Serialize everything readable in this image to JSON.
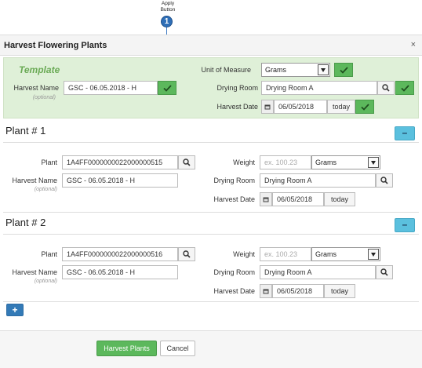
{
  "callout": {
    "label_line1": "Apply",
    "label_line2": "Button",
    "number": "1"
  },
  "dialog": {
    "title": "Harvest Flowering Plants",
    "close": "×"
  },
  "template": {
    "title": "Template",
    "harvest_name_label": "Harvest Name",
    "optional_label": "(optional)",
    "harvest_name_value": "GSC - 06.05.2018 - H",
    "unit_label": "Unit of Measure",
    "unit_value": "Grams",
    "drying_room_label": "Drying Room",
    "drying_room_value": "Drying Room A",
    "harvest_date_label": "Harvest Date",
    "harvest_date_value": "06/05/2018",
    "today_label": "today"
  },
  "plants": [
    {
      "title": "Plant # 1",
      "collapse": "–",
      "plant_label": "Plant",
      "plant_value": "1A4FF0000000022000000515",
      "harvest_name_label": "Harvest Name",
      "optional_label": "(optional)",
      "harvest_name_value": "GSC - 06.05.2018 - H",
      "weight_label": "Weight",
      "weight_placeholder": "ex. 100.23",
      "unit_value": "Grams",
      "drying_room_label": "Drying Room",
      "drying_room_value": "Drying Room A",
      "harvest_date_label": "Harvest Date",
      "harvest_date_value": "06/05/2018",
      "today_label": "today"
    },
    {
      "title": "Plant # 2",
      "collapse": "–",
      "plant_label": "Plant",
      "plant_value": "1A4FF0000000022000000516",
      "harvest_name_label": "Harvest Name",
      "optional_label": "(optional)",
      "harvest_name_value": "GSC - 06.05.2018 - H",
      "weight_label": "Weight",
      "weight_placeholder": "ex. 100.23",
      "unit_value": "Grams",
      "drying_room_label": "Drying Room",
      "drying_room_value": "Drying Room A",
      "harvest_date_label": "Harvest Date",
      "harvest_date_value": "06/05/2018",
      "today_label": "today"
    }
  ],
  "add_button": "+",
  "footer": {
    "submit": "Harvest Plants",
    "cancel": "Cancel"
  },
  "colors": {
    "accent_green": "#5cb85c",
    "template_bg": "#dff0d8",
    "info_blue": "#5bc0de",
    "primary_blue": "#337ab7"
  },
  "icons": {
    "search": "search-icon",
    "check": "check-icon",
    "calendar": "calendar-icon"
  }
}
